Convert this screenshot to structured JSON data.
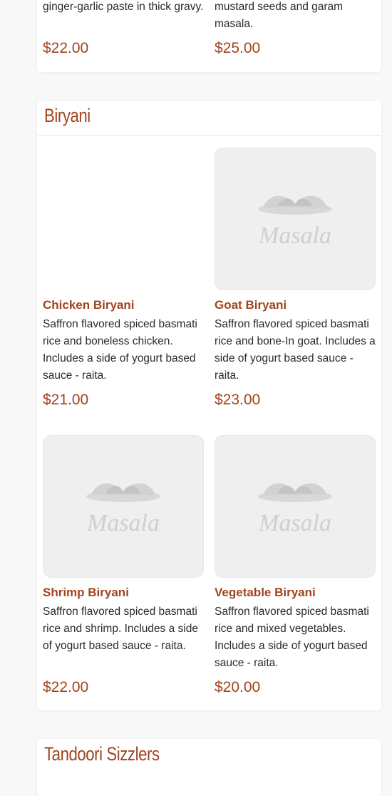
{
  "theme": {
    "accent": "#a0441f",
    "placeholder_bg": "#efefef"
  },
  "top_section": {
    "items": [
      {
        "desc_tail": "ginger-garlic paste in thick gravy.",
        "price": "$22.00"
      },
      {
        "desc_tail": "mustard seeds and garam masala.",
        "price": "$25.00"
      }
    ]
  },
  "biryani": {
    "title": "Biryani",
    "items": [
      {
        "name": "Chicken Biryani",
        "desc": "Saffron flavored spiced basmati rice and boneless chicken. Includes a side of yogurt based sauce - raita.",
        "price": "$21.00",
        "image": "none"
      },
      {
        "name": "Goat Biryani",
        "desc": "Saffron flavored spiced basmati rice and bone-In goat. Includes a side of yogurt based sauce - raita.",
        "price": "$23.00",
        "image": "masala-logo-placeholder"
      },
      {
        "name": "Shrimp Biryani",
        "desc": "Saffron flavored spiced basmati rice and shrimp. Includes a side of yogurt based sauce - raita.",
        "price": "$22.00",
        "image": "masala-logo-placeholder"
      },
      {
        "name": "Vegetable Biryani",
        "desc": "Saffron flavored spiced basmati rice and mixed vegetables. Includes a side of yogurt based sauce - raita.",
        "price": "$20.00",
        "image": "masala-logo-placeholder"
      }
    ]
  },
  "tandoori": {
    "title": "Tandoori Sizzlers"
  },
  "placeholder_logo_text": "Masala"
}
